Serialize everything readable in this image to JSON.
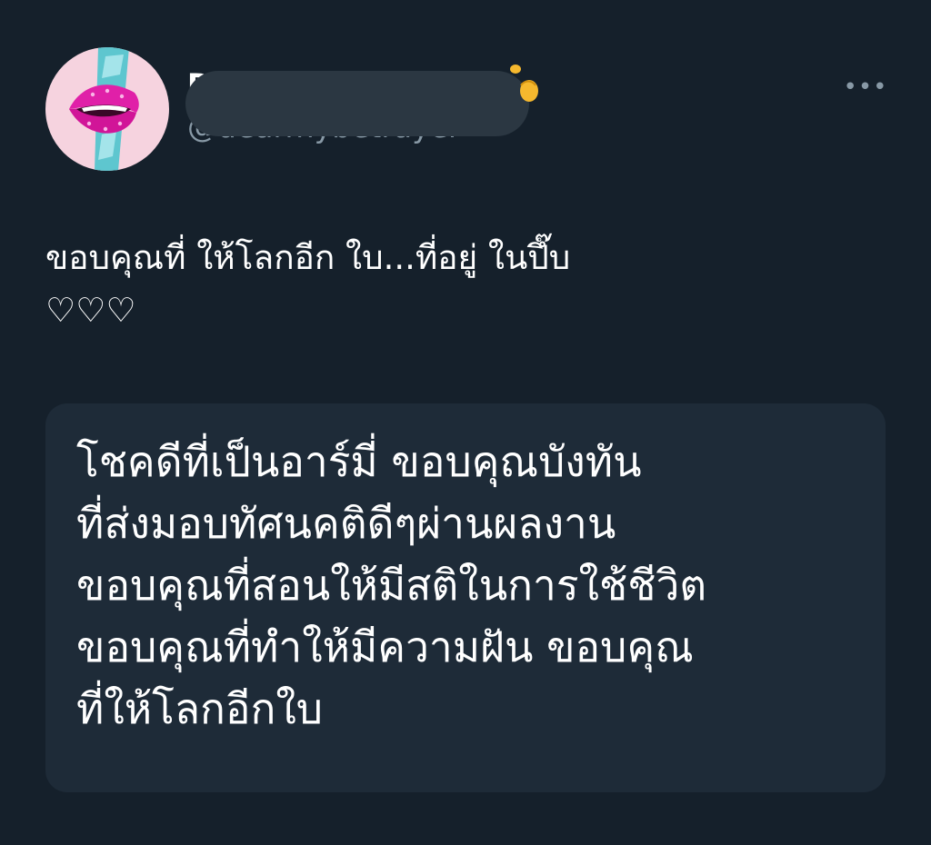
{
  "tweet": {
    "author": {
      "display_name": "D",
      "handle": "@dearmybetrayer",
      "avatar_icon": "lips-avatar-icon",
      "name_emoji_icon": "emoji-icon"
    },
    "more_label": "•••",
    "more_icon": "more-options-icon",
    "text": "ขอบคุณที่ ให้โลกอีก ใบ...ที่อยู่ ในปึ๊บ\n♡♡♡",
    "quote_text": "โชคดีที่เป็นอาร์มี่ ขอบคุณบังทัน\nที่ส่งมอบทัศนคติดีๆผ่านผลงาน\nขอบคุณที่สอนให้มีสติในการใช้ชีวิต\nขอบคุณที่ทำให้มีความฝัน ขอบคุณ\nที่ให้โลกอีกใบ"
  },
  "colors": {
    "background": "#15202b",
    "card": "#1e2b38",
    "secondary_text": "#8899a6",
    "redaction": "#2b3742"
  }
}
